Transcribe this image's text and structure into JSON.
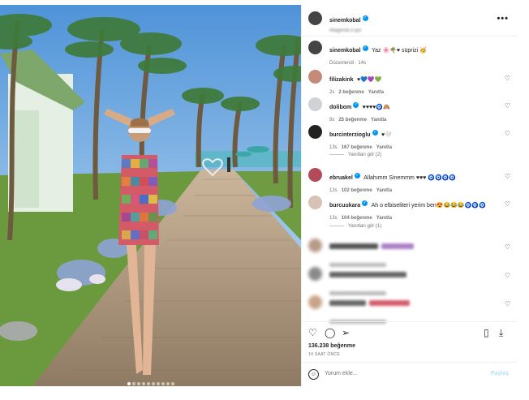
{
  "post": {
    "author": "sinemkobal",
    "location": "iMagenar.ir.qul",
    "caption_user": "sinemkobal",
    "caption_text": "Yaz 🌸🌴♥ süprizi 🥳",
    "caption_meta": "Düzenlendi · 14s",
    "more_icon": "•••"
  },
  "comments": [
    {
      "user": "filizakink",
      "text": "♥💙💜💚",
      "time": "2s",
      "likes": "2 beğenme",
      "reply": "Yanıtla",
      "verified": false
    },
    {
      "user": "dolibom",
      "text": "♥♥♥♥🧿🙈",
      "time": "9s",
      "likes": "25 beğenme",
      "reply": "Yanıtla",
      "verified": true
    },
    {
      "user": "burcinterzioglu",
      "text": "♥🤍",
      "time": "13s",
      "likes": "167 beğenme",
      "reply": "Yanıtla",
      "verified": true,
      "view_replies": "Yanıtları gör (2)"
    },
    {
      "user": "ebruakel",
      "text": "Allahımm Sinemmm ♥♥♥ 🧿🧿🧿🧿",
      "time": "12s",
      "likes": "102 beğenme",
      "reply": "Yanıtla",
      "verified": true
    },
    {
      "user": "burcuukara",
      "text": "Ah o elbiseliteri yerim ben😍😂😂😂🧿🧿🧿",
      "time": "13s",
      "likes": "104 beğenme",
      "reply": "Yanıtla",
      "verified": true,
      "view_replies": "Yanıtları gör (1)"
    }
  ],
  "actions": {
    "likes": "136.238 beğenme",
    "time_ago": "14 SAAT ÖNCE"
  },
  "composer": {
    "placeholder": "Yorum ekle...",
    "post_label": "Paylaş"
  },
  "colors": {
    "verified": "#0095f6",
    "sky": "#7fb6e8",
    "boardwalk": "#b8a48c",
    "grass": "#5d8f3a"
  }
}
